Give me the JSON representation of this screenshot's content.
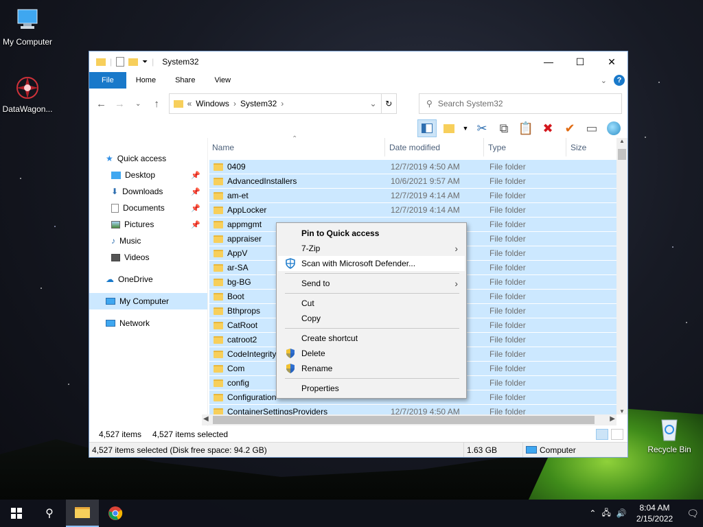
{
  "desktop": {
    "icons": [
      {
        "label": "My Computer"
      },
      {
        "label": "DataWagon..."
      },
      {
        "label": "Recycle Bin"
      }
    ]
  },
  "window": {
    "title": "System32",
    "ribbon_tabs": [
      "File",
      "Home",
      "Share",
      "View"
    ],
    "address": {
      "prefix": "«",
      "crumbs": [
        "Windows",
        "System32"
      ]
    },
    "search_placeholder": "Search System32",
    "columns": [
      "Name",
      "Date modified",
      "Type",
      "Size"
    ],
    "nav": {
      "quick_access": "Quick access",
      "pinned": [
        "Desktop",
        "Downloads",
        "Documents",
        "Pictures"
      ],
      "unpinned": [
        "Music",
        "Videos"
      ],
      "onedrive": "OneDrive",
      "my_computer": "My Computer",
      "network": "Network"
    },
    "files": [
      {
        "name": "0409",
        "date": "12/7/2019 4:50 AM",
        "type": "File folder"
      },
      {
        "name": "AdvancedInstallers",
        "date": "10/6/2021 9:57 AM",
        "type": "File folder"
      },
      {
        "name": "am-et",
        "date": "12/7/2019 4:14 AM",
        "type": "File folder"
      },
      {
        "name": "AppLocker",
        "date": "12/7/2019 4:14 AM",
        "type": "File folder"
      },
      {
        "name": "appmgmt",
        "date": "",
        "type": "File folder"
      },
      {
        "name": "appraiser",
        "date": "",
        "type": "File folder"
      },
      {
        "name": "AppV",
        "date": "",
        "type": "File folder"
      },
      {
        "name": "ar-SA",
        "date": "",
        "type": "File folder"
      },
      {
        "name": "bg-BG",
        "date": "",
        "type": "File folder"
      },
      {
        "name": "Boot",
        "date": "",
        "type": "File folder"
      },
      {
        "name": "Bthprops",
        "date": "",
        "type": "File folder"
      },
      {
        "name": "CatRoot",
        "date": "",
        "type": "File folder"
      },
      {
        "name": "catroot2",
        "date": "",
        "type": "File folder"
      },
      {
        "name": "CodeIntegrity",
        "date": "",
        "type": "File folder"
      },
      {
        "name": "Com",
        "date": "",
        "type": "File folder"
      },
      {
        "name": "config",
        "date": "",
        "type": "File folder"
      },
      {
        "name": "Configuration",
        "date": "",
        "type": "File folder"
      },
      {
        "name": "ContainerSettingsProviders",
        "date": "12/7/2019 4:50 AM",
        "type": "File folder"
      }
    ],
    "status": {
      "items": "4,527 items",
      "selected": "4,527 items selected"
    },
    "details_bar": {
      "summary": "4,527 items selected (Disk free space: 94.2 GB)",
      "size": "1.63 GB",
      "location": "Computer"
    }
  },
  "context_menu": {
    "items": [
      {
        "label": "Pin to Quick access",
        "bold": true
      },
      {
        "label": "7-Zip",
        "submenu": true
      },
      {
        "label": "Scan with Microsoft Defender...",
        "icon": "defender-icon",
        "highlight": true
      },
      {
        "sep": true
      },
      {
        "label": "Send to",
        "submenu": true
      },
      {
        "sep": true
      },
      {
        "label": "Cut"
      },
      {
        "label": "Copy"
      },
      {
        "sep": true
      },
      {
        "label": "Create shortcut"
      },
      {
        "label": "Delete",
        "icon": "shield-icon"
      },
      {
        "label": "Rename",
        "icon": "shield-icon"
      },
      {
        "sep": true
      },
      {
        "label": "Properties"
      }
    ]
  },
  "taskbar": {
    "time": "8:04 AM",
    "date": "2/15/2022"
  },
  "colors": {
    "accent": "#1979ca",
    "selection": "#cce8ff",
    "folder": "#f7cf5b"
  }
}
